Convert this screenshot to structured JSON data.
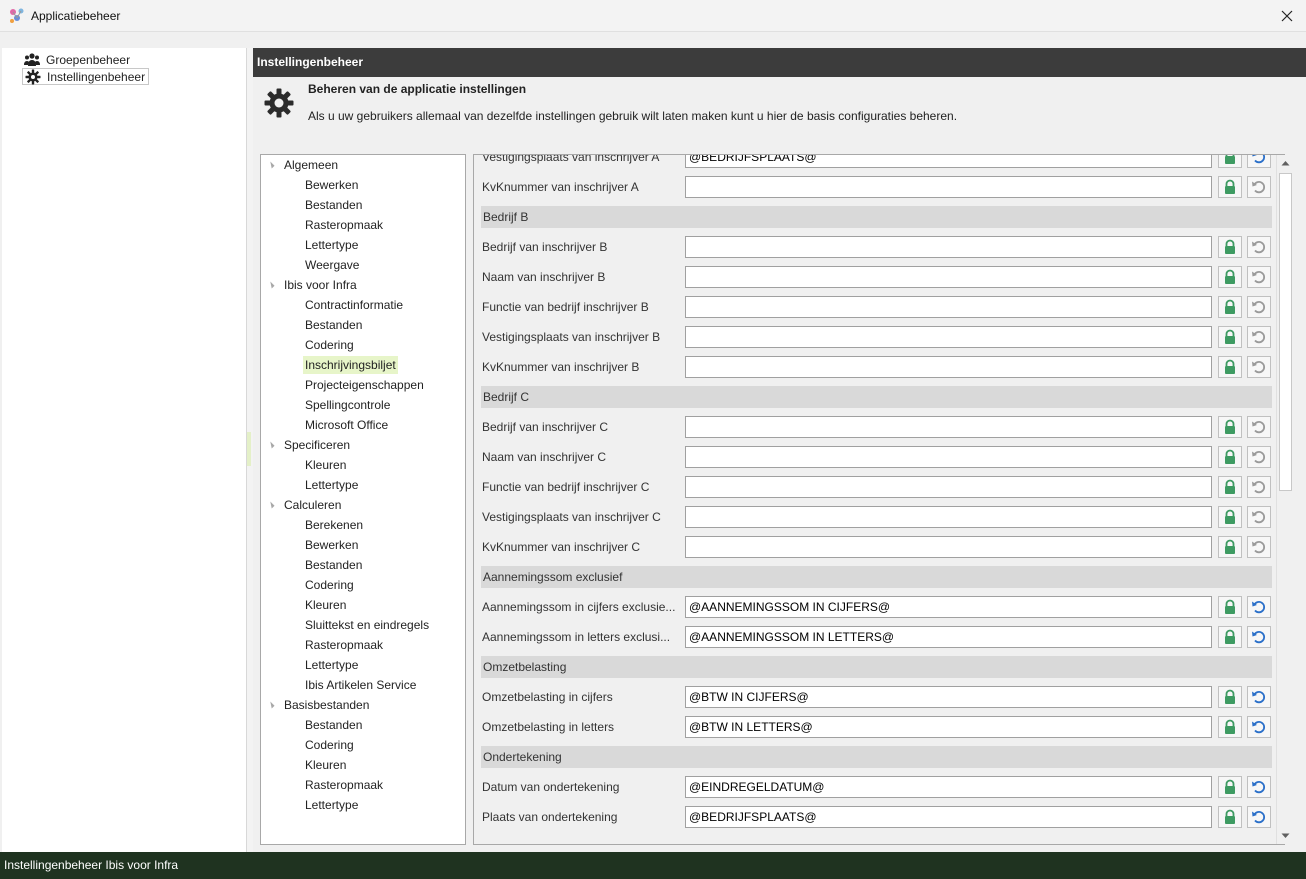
{
  "window": {
    "title": "Applicatiebeheer"
  },
  "left_nav": {
    "items": [
      {
        "label": "Groepenbeheer",
        "icon": "users-icon",
        "selected": false
      },
      {
        "label": "Instellingenbeheer",
        "icon": "gear-icon",
        "selected": true
      }
    ]
  },
  "panel": {
    "header": "Instellingenbeheer",
    "desc_title": "Beheren van de applicatie instellingen",
    "desc_text": "Als u uw gebruikers allemaal van dezelfde instellingen gebruik wilt laten maken kunt u hier de basis configuraties beheren."
  },
  "tree": [
    {
      "label": "Algemeen",
      "level": 0
    },
    {
      "label": "Bewerken",
      "level": 1
    },
    {
      "label": "Bestanden",
      "level": 1
    },
    {
      "label": "Rasteropmaak",
      "level": 1
    },
    {
      "label": "Lettertype",
      "level": 1
    },
    {
      "label": "Weergave",
      "level": 1
    },
    {
      "label": "Ibis voor Infra",
      "level": 0
    },
    {
      "label": "Contractinformatie",
      "level": 1
    },
    {
      "label": "Bestanden",
      "level": 1
    },
    {
      "label": "Codering",
      "level": 1
    },
    {
      "label": "Inschrijvingsbiljet",
      "level": 1,
      "selected": true
    },
    {
      "label": "Projecteigenschappen",
      "level": 1
    },
    {
      "label": "Spellingcontrole",
      "level": 1
    },
    {
      "label": "Microsoft Office",
      "level": 1
    },
    {
      "label": "Specificeren",
      "level": 0
    },
    {
      "label": "Kleuren",
      "level": 1
    },
    {
      "label": "Lettertype",
      "level": 1
    },
    {
      "label": "Calculeren",
      "level": 0
    },
    {
      "label": "Berekenen",
      "level": 1
    },
    {
      "label": "Bewerken",
      "level": 1
    },
    {
      "label": "Bestanden",
      "level": 1
    },
    {
      "label": "Codering",
      "level": 1
    },
    {
      "label": "Kleuren",
      "level": 1
    },
    {
      "label": "Sluittekst en eindregels",
      "level": 1
    },
    {
      "label": "Rasteropmaak",
      "level": 1
    },
    {
      "label": "Lettertype",
      "level": 1
    },
    {
      "label": "Ibis Artikelen Service",
      "level": 1
    },
    {
      "label": "Basisbestanden",
      "level": 0
    },
    {
      "label": "Bestanden",
      "level": 1
    },
    {
      "label": "Codering",
      "level": 1
    },
    {
      "label": "Kleuren",
      "level": 1
    },
    {
      "label": "Rasteropmaak",
      "level": 1
    },
    {
      "label": "Lettertype",
      "level": 1
    }
  ],
  "settings_rows": [
    {
      "type": "field",
      "label": "Vestigingsplaats van inschrijver A",
      "value": "@BEDRIJFSPLAATS@",
      "modified": true,
      "partial": true
    },
    {
      "type": "field",
      "label": "KvKnummer van inschrijver A",
      "value": "",
      "modified": false
    },
    {
      "type": "section",
      "label": "Bedrijf B"
    },
    {
      "type": "field",
      "label": "Bedrijf van inschrijver B",
      "value": "",
      "modified": false
    },
    {
      "type": "field",
      "label": "Naam van inschrijver B",
      "value": "",
      "modified": false
    },
    {
      "type": "field",
      "label": "Functie van bedrijf inschrijver B",
      "value": "",
      "modified": false
    },
    {
      "type": "field",
      "label": "Vestigingsplaats van inschrijver B",
      "value": "",
      "modified": false
    },
    {
      "type": "field",
      "label": "KvKnummer van inschrijver B",
      "value": "",
      "modified": false
    },
    {
      "type": "section",
      "label": "Bedrijf C"
    },
    {
      "type": "field",
      "label": "Bedrijf van inschrijver C",
      "value": "",
      "modified": false
    },
    {
      "type": "field",
      "label": "Naam van inschrijver C",
      "value": "",
      "modified": false
    },
    {
      "type": "field",
      "label": "Functie van bedrijf inschrijver C",
      "value": "",
      "modified": false
    },
    {
      "type": "field",
      "label": "Vestigingsplaats van inschrijver C",
      "value": "",
      "modified": false
    },
    {
      "type": "field",
      "label": "KvKnummer van inschrijver C",
      "value": "",
      "modified": false
    },
    {
      "type": "section",
      "label": "Aannemingssom exclusief"
    },
    {
      "type": "field",
      "label": "Aannemingssom in cijfers exclusie...",
      "value": "@AANNEMINGSSOM IN CIJFERS@",
      "modified": true
    },
    {
      "type": "field",
      "label": "Aannemingssom in letters exclusi...",
      "value": "@AANNEMINGSSOM IN LETTERS@",
      "modified": true
    },
    {
      "type": "section",
      "label": "Omzetbelasting"
    },
    {
      "type": "field",
      "label": "Omzetbelasting in cijfers",
      "value": "@BTW IN CIJFERS@",
      "modified": true
    },
    {
      "type": "field",
      "label": "Omzetbelasting in letters",
      "value": "@BTW IN LETTERS@",
      "modified": true
    },
    {
      "type": "section",
      "label": "Ondertekening"
    },
    {
      "type": "field",
      "label": "Datum van ondertekening",
      "value": "@EINDREGELDATUM@",
      "modified": true
    },
    {
      "type": "field",
      "label": "Plaats van ondertekening",
      "value": "@BEDRIJFSPLAATS@",
      "modified": true
    }
  ],
  "status": {
    "text": "Instellingenbeheer Ibis voor Infra"
  },
  "colors": {
    "header_bg": "#3c3c3c",
    "status_bg": "#1f3320",
    "lock_green": "#3e9b62",
    "reset_blue": "#2a6fc9",
    "reset_gray": "#9a9a9a",
    "tree_selected": "#e7f5c9"
  }
}
